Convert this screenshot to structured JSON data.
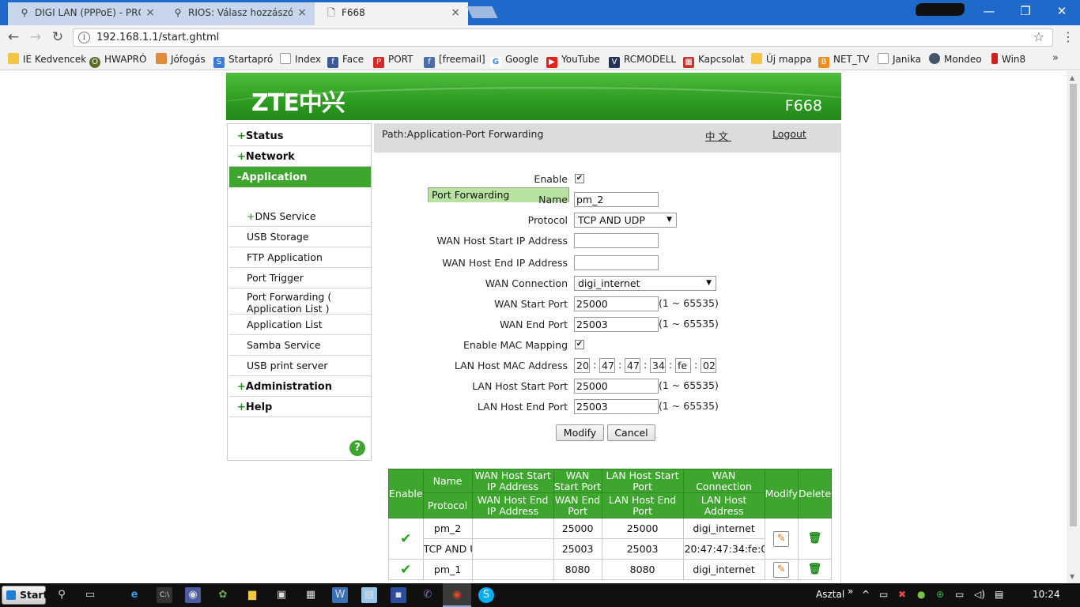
{
  "browser": {
    "tabs": [
      {
        "label": "DIGI LAN (PPPoE) - PROH",
        "icon": "search-icon",
        "close": "×"
      },
      {
        "label": "RIOS: Válasz hozzászólás",
        "icon": "search-icon",
        "close": "×"
      },
      {
        "label": "F668",
        "icon": "page-icon",
        "close": "×"
      }
    ],
    "window_controls": {
      "minimize": "—",
      "restore": "❐",
      "close": "✕"
    },
    "url": "192.168.1.1/start.ghtml",
    "bookmarks": [
      {
        "label": "IE Kedvencek",
        "icon": "folder-icon",
        "color": "#f4c542"
      },
      {
        "label": "HWAPRÓ",
        "icon": "hwapro-icon",
        "color": "#5b6b2a"
      },
      {
        "label": "Jófogás",
        "icon": "box-icon",
        "color": "#e08a3a"
      },
      {
        "label": "Startapró",
        "icon": "s-icon",
        "color": "#3a7bd5"
      },
      {
        "label": "Index",
        "icon": "page-icon",
        "color": "#888888"
      },
      {
        "label": "Face",
        "icon": "facebook-icon",
        "color": "#3b5998"
      },
      {
        "label": "PORT",
        "icon": "p-icon",
        "color": "#d62828"
      },
      {
        "label": "[freemail]",
        "icon": "f-icon",
        "color": "#4a6fa5"
      },
      {
        "label": "Google",
        "icon": "google-icon",
        "color": "#4285f4"
      },
      {
        "label": "YouTube",
        "icon": "youtube-icon",
        "color": "#e62117"
      },
      {
        "label": "RCMODELL",
        "icon": "rc-icon",
        "color": "#223355"
      },
      {
        "label": "Kapcsolat",
        "icon": "grid-icon",
        "color": "#c0392b"
      },
      {
        "label": "Új mappa",
        "icon": "folder-icon",
        "color": "#f4c542"
      },
      {
        "label": "NET_TV",
        "icon": "b-icon",
        "color": "#f08c1a"
      },
      {
        "label": "Janika",
        "icon": "page-icon",
        "color": "#888888"
      },
      {
        "label": "Mondeo",
        "icon": "car-icon",
        "color": "#44556a"
      },
      {
        "label": "Win8",
        "icon": "bars-icon",
        "color": "#cc2222"
      }
    ],
    "more": "»"
  },
  "router": {
    "brand": "ZTE中兴",
    "model": "F668",
    "path": "Path:Application-Port Forwarding",
    "language_link": "中文",
    "logout": "Logout",
    "menu": {
      "status": {
        "sign": "+",
        "label": "Status"
      },
      "network": {
        "sign": "+",
        "label": "Network"
      },
      "application": {
        "sign": "-",
        "label": "Application"
      },
      "sub": [
        {
          "label": "Port Forwarding"
        },
        {
          "sign": "+",
          "label": "DNS Service"
        },
        {
          "label": "USB Storage"
        },
        {
          "label": "FTP Application"
        },
        {
          "label": "Port Trigger"
        },
        {
          "label": "Port Forwarding (",
          "label2": "Application List )"
        },
        {
          "label": "Application List"
        },
        {
          "label": "Samba Service"
        },
        {
          "label": "USB print server"
        }
      ],
      "administration": {
        "sign": "+",
        "label": "Administration"
      },
      "help": {
        "sign": "+",
        "label": "Help"
      },
      "help_icon": "?"
    },
    "form": {
      "enable": {
        "label": "Enable",
        "checked": "✔"
      },
      "name": {
        "label": "Name",
        "value": "pm_2"
      },
      "protocol": {
        "label": "Protocol",
        "value": "TCP AND UDP"
      },
      "wan_host_start_ip": {
        "label": "WAN Host Start IP Address",
        "value": ""
      },
      "wan_host_end_ip": {
        "label": "WAN Host End IP Address",
        "value": ""
      },
      "wan_connection": {
        "label": "WAN Connection",
        "value": "digi_internet"
      },
      "wan_start_port": {
        "label": "WAN Start Port",
        "value": "25000",
        "range": "(1 ~ 65535)"
      },
      "wan_end_port": {
        "label": "WAN End Port",
        "value": "25003",
        "range": "(1 ~ 65535)"
      },
      "enable_mac_mapping": {
        "label": "Enable MAC Mapping",
        "checked": "✔"
      },
      "lan_host_mac": {
        "label": "LAN Host MAC Address",
        "parts": [
          "20",
          "47",
          "47",
          "34",
          "fe",
          "02"
        ],
        "sep": ":"
      },
      "lan_host_start_port": {
        "label": "LAN Host Start Port",
        "value": "25000",
        "range": "(1 ~ 65535)"
      },
      "lan_host_end_port": {
        "label": "LAN Host End Port",
        "value": "25003",
        "range": "(1 ~ 65535)"
      },
      "modify": "Modify",
      "cancel": "Cancel"
    },
    "table": {
      "headers": {
        "enable": "Enable",
        "name": "Name",
        "protocol": "Protocol",
        "wan_start_ip": "WAN Host Start IP Address",
        "wan_end_ip": "WAN Host End IP Address",
        "wan_start_port": "WAN Start Port",
        "wan_end_port": "WAN End Port",
        "lan_start_port": "LAN Host Start Port",
        "lan_end_port": "LAN Host End Port",
        "wan_connection": "WAN Connection",
        "lan_host_address": "LAN Host Address",
        "modify": "Modify",
        "delete": "Delete"
      },
      "rows": [
        {
          "enabled": "✔",
          "name": "pm_2",
          "protocol": "TCP AND U",
          "wan_start_ip": "",
          "wan_end_ip": "",
          "wan_start_port": "25000",
          "wan_end_port": "25003",
          "lan_start_port": "25000",
          "lan_end_port": "25003",
          "wan_connection": "digi_internet",
          "lan_host_address": "20:47:47:34:fe:0"
        },
        {
          "enabled": "✔",
          "name": "pm_1",
          "protocol": "",
          "wan_start_ip": "",
          "wan_end_ip": "",
          "wan_start_port": "8080",
          "wan_end_port": "",
          "lan_start_port": "8080",
          "lan_end_port": "",
          "wan_connection": "digi_internet",
          "lan_host_address": ""
        }
      ]
    }
  },
  "taskbar": {
    "start": "Start",
    "desktop_label": "Asztal",
    "chevron": "»",
    "time": "10:24"
  }
}
